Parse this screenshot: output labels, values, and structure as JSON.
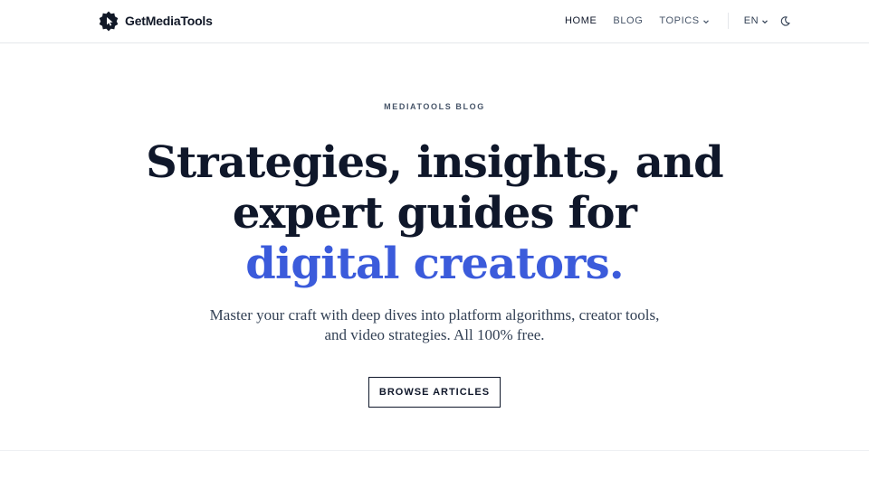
{
  "header": {
    "brand_name": "GetMediaTools",
    "nav": {
      "home": "HOME",
      "blog": "BLOG",
      "topics": "TOPICS",
      "language": "EN"
    }
  },
  "hero": {
    "eyebrow": "MEDIATOOLS BLOG",
    "headline_line1": "Strategies, insights, and",
    "headline_line2": "expert guides for",
    "headline_accent": "digital creators.",
    "subtitle": "Master your craft with deep dives into platform algorithms, creator tools, and video strategies. All 100% free.",
    "cta_label": "BROWSE ARTICLES"
  },
  "colors": {
    "accent": "#3b5bdb",
    "text": "#0f172a",
    "muted": "#475569"
  },
  "icons": [
    "logo-icon",
    "chevron-down-icon",
    "moon-icon"
  ]
}
